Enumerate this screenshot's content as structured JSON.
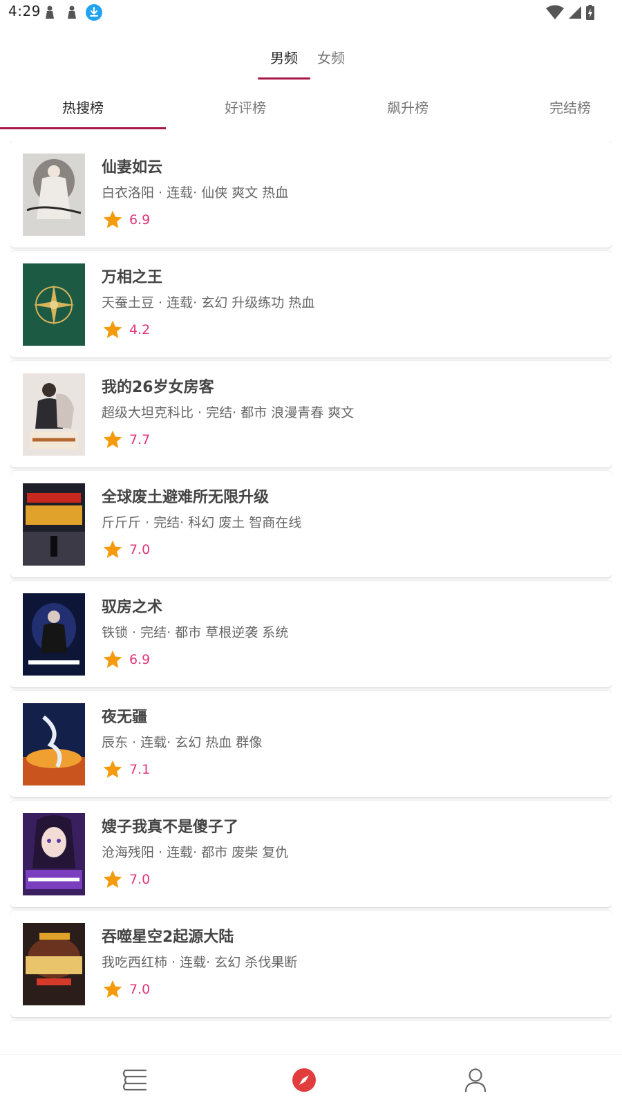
{
  "status_bar": {
    "time": "4:29"
  },
  "gender_tabs": [
    {
      "label": "男频",
      "active": true
    },
    {
      "label": "女频",
      "active": false
    }
  ],
  "rank_tabs": [
    {
      "label": "热搜榜",
      "active": true
    },
    {
      "label": "好评榜",
      "active": false
    },
    {
      "label": "飙升榜",
      "active": false
    },
    {
      "label": "完结榜",
      "active": false
    }
  ],
  "books": [
    {
      "title": "仙妻如云",
      "meta": "白衣洛阳 · 连载· 仙侠 爽文 热血",
      "rating": "6.9"
    },
    {
      "title": "万相之王",
      "meta": "天蚕土豆 · 连载· 玄幻 升级练功 热血",
      "rating": "4.2"
    },
    {
      "title": "我的26岁女房客",
      "meta": "超级大坦克科比 · 完结· 都市 浪漫青春 爽文",
      "rating": "7.7"
    },
    {
      "title": "全球废土避难所无限升级",
      "meta": "斤斤斤 · 完结· 科幻 废土 智商在线",
      "rating": "7.0"
    },
    {
      "title": "驭房之术",
      "meta": "铁锁 · 完结· 都市 草根逆袭 系统",
      "rating": "6.9"
    },
    {
      "title": "夜无疆",
      "meta": "辰东 · 连载· 玄幻 热血 群像",
      "rating": "7.1"
    },
    {
      "title": "嫂子我真不是傻子了",
      "meta": "沧海残阳 · 连载· 都市 废柴 复仇",
      "rating": "7.0"
    },
    {
      "title": "吞噬星空2起源大陆",
      "meta": "我吃西红柿 · 连载· 玄幻 杀伐果断",
      "rating": "7.0"
    }
  ],
  "colors": {
    "accent": "#a8174a",
    "rating_text": "#e0347a",
    "star": "#f59a0c"
  },
  "bottom_nav": [
    {
      "icon": "bookshelf-icon"
    },
    {
      "icon": "discover-compass-icon",
      "active": true
    },
    {
      "icon": "profile-icon"
    }
  ]
}
